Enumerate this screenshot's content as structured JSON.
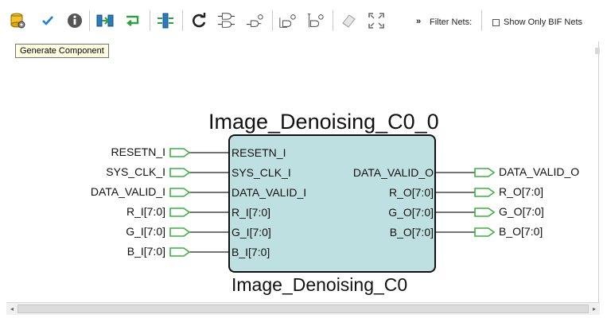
{
  "toolbar": {
    "buttons": [
      {
        "icon": "generate-component-icon"
      },
      {
        "icon": "check-icon"
      },
      {
        "icon": "info-icon"
      },
      {
        "icon": "auto-connect-icon"
      },
      {
        "icon": "wire-icon"
      },
      {
        "icon": "split-icon"
      },
      {
        "icon": "refresh-icon"
      },
      {
        "icon": "flip-horizontal-icon"
      },
      {
        "icon": "promote-to-top-icon"
      },
      {
        "icon": "gate-a-icon"
      },
      {
        "icon": "gate-b-icon"
      },
      {
        "icon": "eraser-icon"
      },
      {
        "icon": "fit-view-icon"
      }
    ],
    "overflow": "»",
    "filter_label": "Filter Nets:",
    "show_bif_label": "Show Only BIF Nets",
    "show_bif_checked": false
  },
  "tooltip": "Generate Component",
  "component": {
    "instance_name": "Image_Denoising_C0_0",
    "type_name": "Image_Denoising_C0",
    "fill_color": "#bfe0e0",
    "inputs": [
      "RESETN_I",
      "SYS_CLK_I",
      "DATA_VALID_I",
      "R_I[7:0]",
      "G_I[7:0]",
      "B_I[7:0]"
    ],
    "outputs": [
      "DATA_VALID_O",
      "R_O[7:0]",
      "G_O[7:0]",
      "B_O[7:0]"
    ]
  },
  "external_ports": {
    "inputs": [
      "RESETN_I",
      "SYS_CLK_I",
      "DATA_VALID_I",
      "R_I[7:0]",
      "G_I[7:0]",
      "B_I[7:0]"
    ],
    "outputs": [
      "DATA_VALID_O",
      "R_O[7:0]",
      "G_O[7:0]",
      "B_O[7:0]"
    ],
    "port_color": "#3cb043"
  }
}
